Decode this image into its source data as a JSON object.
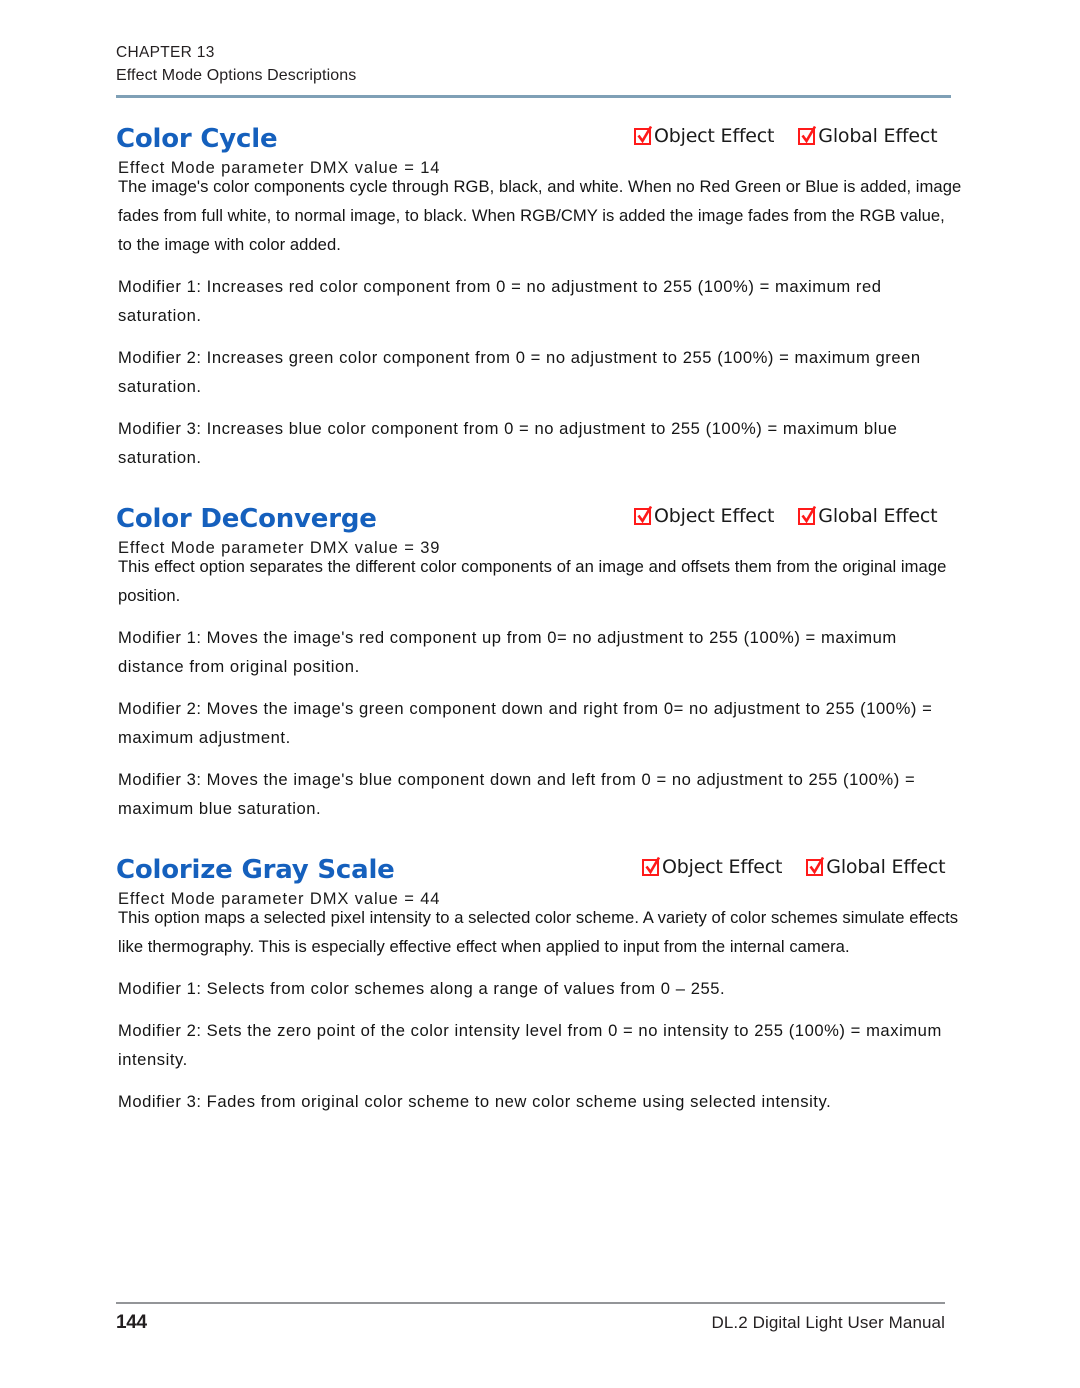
{
  "header": {
    "chapter": "CHAPTER 13",
    "subtitle": "Effect Mode Options Descriptions",
    "rule_color": "#7fa0b6"
  },
  "theme": {
    "heading_color": "#1560bd",
    "checkbox_color": "#ff1a1a",
    "text_color": "#141414"
  },
  "checkbox_labels": {
    "object": "Object Effect",
    "global": "Global Effect"
  },
  "sections": [
    {
      "title": "Color Cycle",
      "subtitle": "Effect Mode parameter DMX value =  14",
      "dmx_value": "14",
      "object_effect_checked": true,
      "global_effect_checked": true,
      "paragraphs": [
        "The image's color components cycle through RGB, black, and white. When no Red Green or Blue is added, image fades from full white, to normal image, to black. When RGB/CMY is added the image fades from the RGB value, to the image with color added.",
        "Modifier 1: Increases red color component from 0 = no adjustment to 255 (100%) = maximum red saturation.",
        "Modifier 2: Increases green color component from 0 = no adjustment to 255 (100%) = maximum green saturation.",
        "Modifier 3: Increases blue color component from 0 = no adjustment to 255 (100%) = maximum blue saturation."
      ]
    },
    {
      "title": "Color DeConverge",
      "subtitle": "Effect Mode parameter DMX value =  39",
      "dmx_value": "39",
      "object_effect_checked": true,
      "global_effect_checked": true,
      "paragraphs": [
        "This effect option separates the different color components of an image and offsets them from the original image position.",
        "Modifier 1: Moves the image's red component up from 0= no adjustment to 255 (100%) = maximum distance from original position.",
        "Modifier 2: Moves the image's green component down and right from 0= no adjustment to 255 (100%) = maximum adjustment.",
        "Modifier 3: Moves the image's blue component down and left from 0 = no adjustment to 255 (100%) = maximum blue saturation."
      ]
    },
    {
      "title": "Colorize Gray Scale",
      "subtitle": "Effect Mode parameter DMX value =  44",
      "dmx_value": "44",
      "object_effect_checked": true,
      "global_effect_checked": true,
      "paragraphs": [
        "This option maps a selected pixel intensity to a selected color scheme. A variety of color schemes simulate effects like thermography. This is especially effective effect when applied to input from the internal camera.",
        "Modifier 1: Selects from color schemes along a range of values from 0 – 255.",
        "Modifier 2: Sets the zero point of the color intensity level from 0 = no intensity to 255 (100%) = maximum intensity.",
        "Modifier 3: Fades from original color scheme to new color scheme using selected intensity."
      ]
    }
  ],
  "footer": {
    "page_number": "144",
    "manual_title": "DL.2 Digital Light User Manual"
  }
}
